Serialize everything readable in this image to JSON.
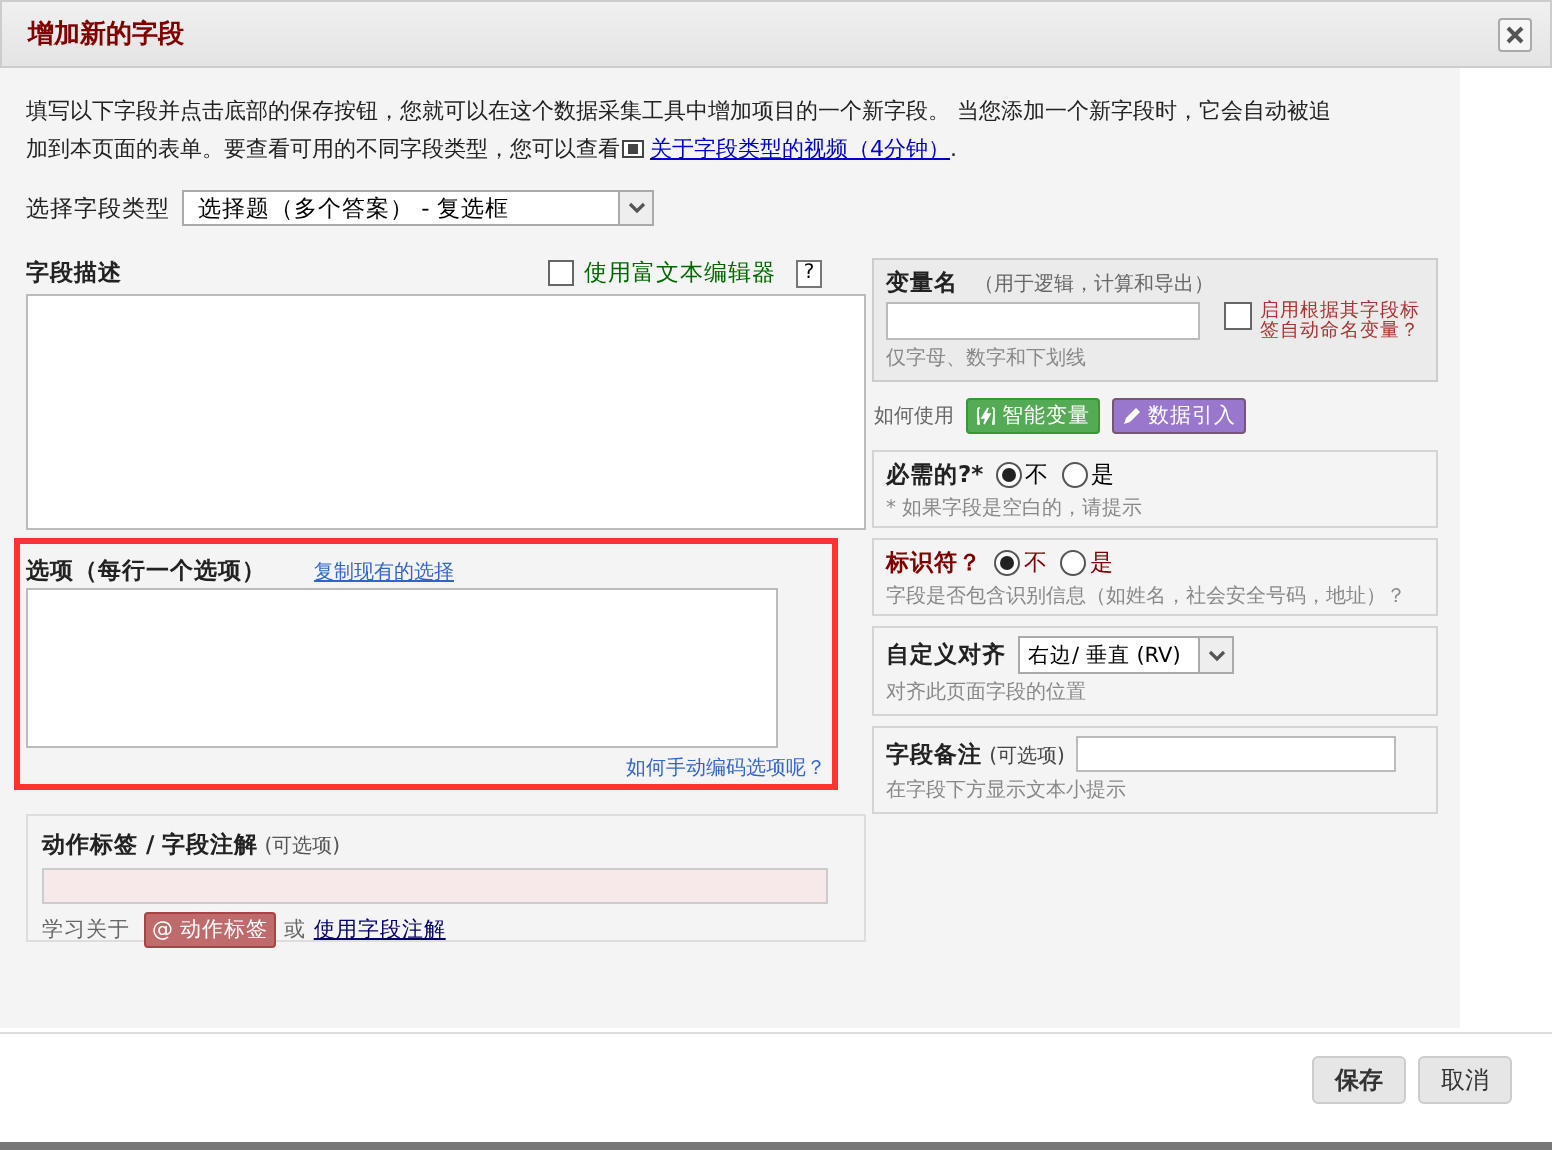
{
  "window": {
    "title": "增加新的字段"
  },
  "intro": {
    "text": "填写以下字段并点击底部的保存按钮，您就可以在这个数据采集工具中增加项目的一个新字段。 当您添加一个新字段时，它会自动被追加到本页面的表单。要查看可用的不同字段类型，您可以查看",
    "link": "关于字段类型的视频（4分钟）",
    "end": "."
  },
  "field_type": {
    "label": "选择字段类型",
    "value": "选择题（多个答案） - 复选框"
  },
  "description": {
    "label": "字段描述",
    "rich_text_editor": {
      "label": "使用富文本编辑器",
      "checked": false
    },
    "help": "?"
  },
  "options": {
    "label": "选项（每行一个选项）",
    "copy_link": "复制现有的选择",
    "help_link": "如何手动编码选项呢？"
  },
  "action_tags": {
    "label": "动作标签 / 字段注解",
    "optional": "(可选项)",
    "learn": "学习关于",
    "badge": "@ 动作标签",
    "or": "或",
    "link": "使用字段注解"
  },
  "variable": {
    "label": "变量名",
    "note": "（用于逻辑，计算和导出）",
    "hint": "仅字母、数字和下划线",
    "auto_name": {
      "label": "启用根据其字段标签自动命名变量？",
      "checked": false
    }
  },
  "usage": {
    "label": "如何使用",
    "buttons": [
      {
        "kind": "smart",
        "label": "智能变量"
      },
      {
        "kind": "piping",
        "label": "数据引入"
      }
    ]
  },
  "radio_panels": [
    {
      "kind": "required",
      "label": "必需的?*",
      "hint": "* 如果字段是空白的，请提示",
      "options": [
        {
          "label": "不",
          "selected": true
        },
        {
          "label": "是",
          "selected": false
        }
      ]
    },
    {
      "kind": "identifier",
      "label": "标识符？",
      "hint": "字段是否包含识别信息（如姓名，社会安全号码，地址）？",
      "options": [
        {
          "label": "不",
          "selected": true
        },
        {
          "label": "是",
          "selected": false
        }
      ]
    }
  ],
  "alignment": {
    "label": "自定义对齐",
    "value": "右边/ 垂直 (RV)",
    "hint": "对齐此页面字段的位置"
  },
  "field_note": {
    "label": "字段备注",
    "optional": "(可选项)",
    "hint": "在字段下方显示文本小提示"
  },
  "buttons": [
    "保存",
    "取消"
  ]
}
